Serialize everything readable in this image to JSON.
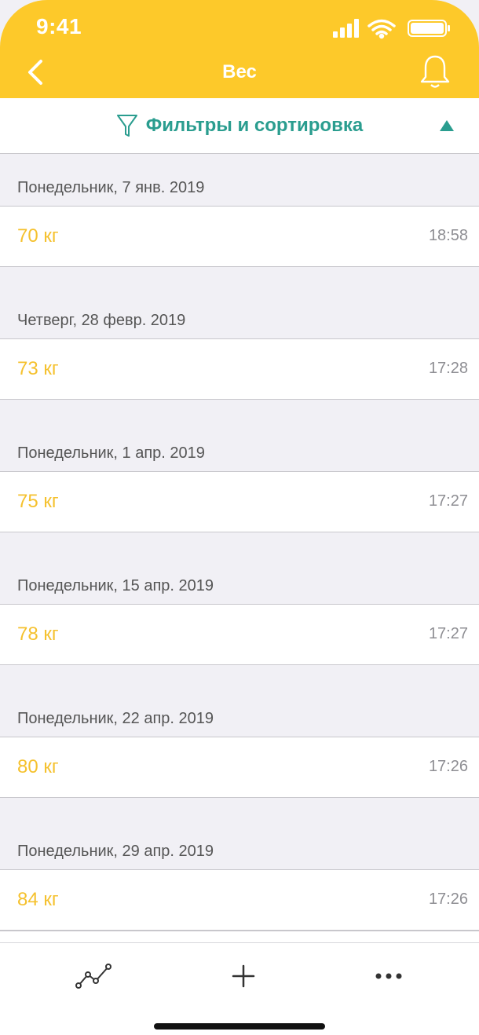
{
  "status_bar": {
    "time": "9:41"
  },
  "nav": {
    "title": "Вес"
  },
  "filter": {
    "label": "Фильтры и сортировка"
  },
  "entries": [
    {
      "date": "Понедельник, 7 янв. 2019",
      "weight": "70 кг",
      "time": "18:58"
    },
    {
      "date": "Четверг, 28 февр. 2019",
      "weight": "73 кг",
      "time": "17:28"
    },
    {
      "date": "Понедельник, 1 апр. 2019",
      "weight": "75 кг",
      "time": "17:27"
    },
    {
      "date": "Понедельник, 15 апр. 2019",
      "weight": "78 кг",
      "time": "17:27"
    },
    {
      "date": "Понедельник, 22 апр. 2019",
      "weight": "80 кг",
      "time": "17:26"
    },
    {
      "date": "Понедельник, 29 апр. 2019",
      "weight": "84 кг",
      "time": "17:26"
    }
  ],
  "icons": {
    "back": "chevron-left-icon",
    "bell": "bell-icon",
    "filter": "funnel-icon",
    "collapse": "triangle-up-icon",
    "chart": "line-chart-icon",
    "add": "plus-icon",
    "more": "ellipsis-icon"
  },
  "colors": {
    "header": "#fdc92a",
    "accent": "#2a9d8f",
    "weight": "#f5c12e",
    "time": "#8e8e93"
  }
}
